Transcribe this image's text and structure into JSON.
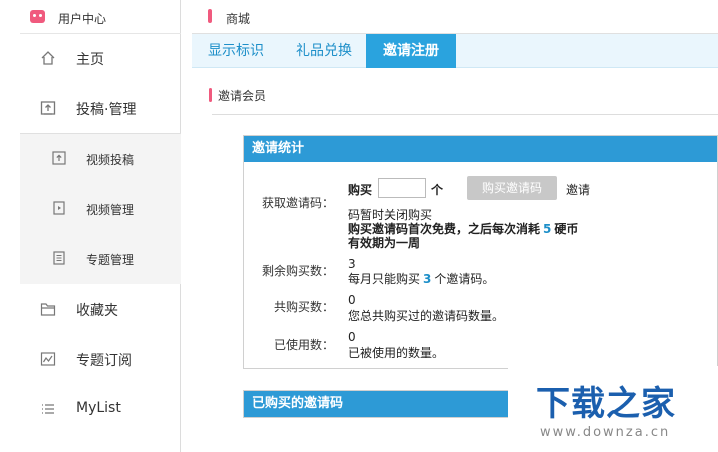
{
  "sidebar": {
    "title": "用户中心",
    "items": [
      {
        "label": "主页",
        "icon": "home-icon"
      },
      {
        "label": "投稿·管理",
        "icon": "upload-icon"
      },
      {
        "label": "收藏夹",
        "icon": "folder-icon"
      },
      {
        "label": "专题订阅",
        "icon": "chart-icon"
      },
      {
        "label": "MyList",
        "icon": "list-icon"
      }
    ],
    "subitems": [
      {
        "label": "视频投稿",
        "icon": "upload-small-icon"
      },
      {
        "label": "视频管理",
        "icon": "video-icon"
      },
      {
        "label": "专题管理",
        "icon": "document-icon"
      }
    ]
  },
  "header": {
    "title": "商城"
  },
  "tabs": [
    {
      "label": "显示标识",
      "active": false
    },
    {
      "label": "礼品兑换",
      "active": false
    },
    {
      "label": "邀请注册",
      "active": true
    }
  ],
  "section": {
    "label": "邀请会员"
  },
  "stats": {
    "title": "邀请统计",
    "get_code": {
      "label": "获取邀请码：",
      "buy_prefix": "购买",
      "unit": "个",
      "button": "购买邀请码",
      "trailing": "邀请",
      "closed_note": "码暂时关闭购买",
      "price_note_a": "购买邀请码首次免费，之后每次消耗",
      "price_value": "5",
      "price_note_b": "硬币",
      "validity": "有效期为一周"
    },
    "remaining": {
      "label": "剩余购买数：",
      "value": "3",
      "desc_a": "每月只能购买",
      "desc_value": "3",
      "desc_b": "个邀请码。"
    },
    "total": {
      "label": "共购买数：",
      "value": "0",
      "desc": "您总共购买过的邀请码数量。"
    },
    "used": {
      "label": "已使用数：",
      "value": "0",
      "desc": "已被使用的数量。"
    }
  },
  "bought": {
    "title": "已购买的邀请码"
  },
  "watermark": {
    "brand": "下载之家",
    "url": "www.downza.cn"
  },
  "colors": {
    "accent": "#2aa3de",
    "panel_head": "#2d9ad6",
    "pink": "#e94c86",
    "tab_bg": "#eaf6fd"
  }
}
